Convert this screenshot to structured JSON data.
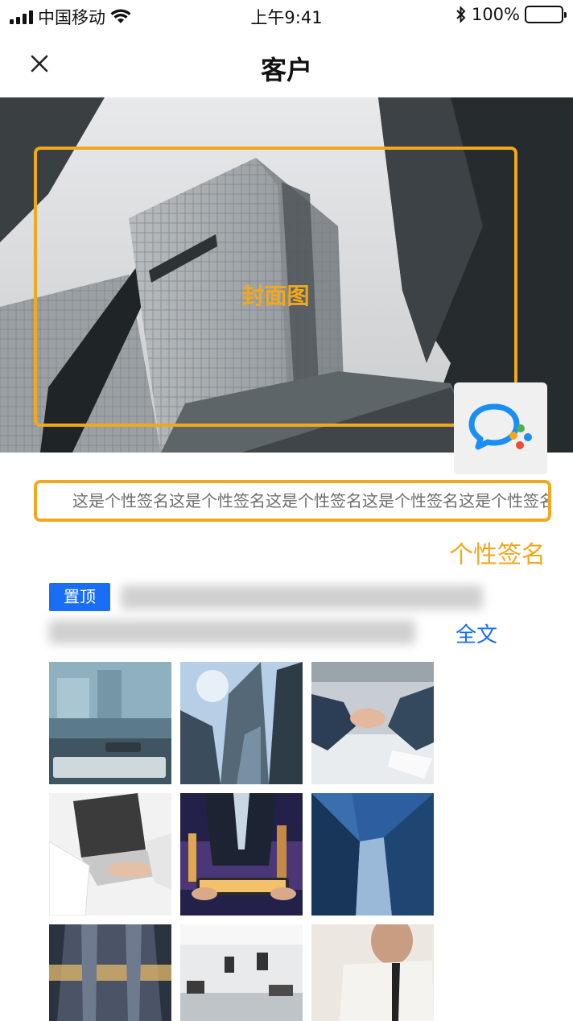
{
  "status_bar": {
    "carrier": "中国移动",
    "time": "上午9:41",
    "battery": "100%"
  },
  "nav": {
    "title": "客户"
  },
  "cover": {
    "label": "封面图"
  },
  "signature": {
    "text": "这是个性签名这是个性签名这是个性签名这是个性签名这是个性签名",
    "label": "个性签名"
  },
  "post": {
    "pin_label": "置顶",
    "full_text_link": "全文"
  },
  "colors": {
    "accent_orange": "#f2a81d",
    "link_blue": "#1a6ef5"
  },
  "photos": [
    {
      "icon": "keyboard-desk-photo"
    },
    {
      "icon": "skyscrapers-photo"
    },
    {
      "icon": "handshake-photo"
    },
    {
      "icon": "laptop-typing-photo"
    },
    {
      "icon": "businessman-tablet-photo"
    },
    {
      "icon": "glass-towers-photo"
    },
    {
      "icon": "building-sunset-photo"
    },
    {
      "icon": "office-interior-photo"
    },
    {
      "icon": "man-tie-photo"
    }
  ]
}
